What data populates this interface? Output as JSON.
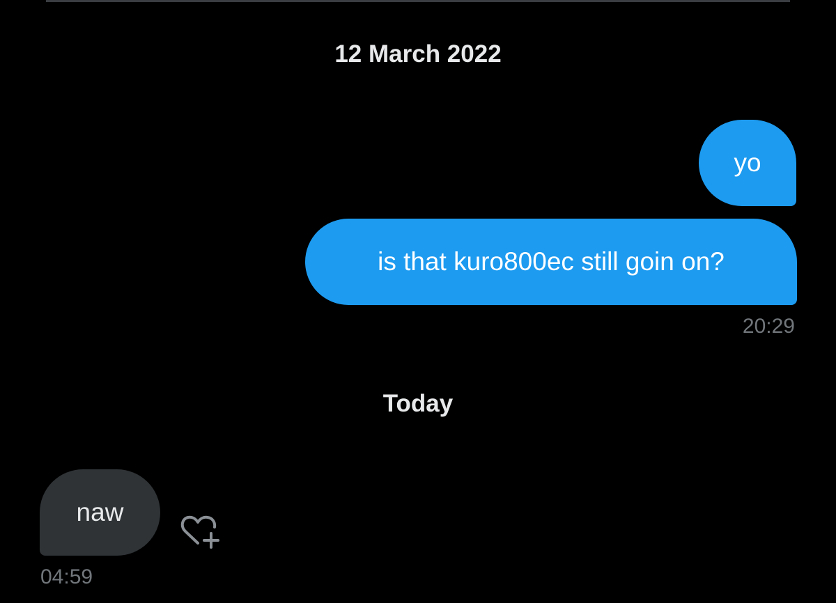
{
  "conversation": {
    "date_separators": [
      "12 March 2022",
      "Today"
    ],
    "messages": [
      {
        "direction": "sent",
        "text": "yo"
      },
      {
        "direction": "sent",
        "text": "is that kuro800ec still goin on?",
        "time": "20:29"
      },
      {
        "direction": "received",
        "text": "naw",
        "time": "04:59"
      }
    ],
    "reaction_icon": "heart-plus-icon"
  },
  "colors": {
    "background": "#000000",
    "sent_bubble": "#1d9bf0",
    "received_bubble": "#2f3336",
    "timestamp": "#71767b",
    "date_text": "#e7e9ea"
  }
}
